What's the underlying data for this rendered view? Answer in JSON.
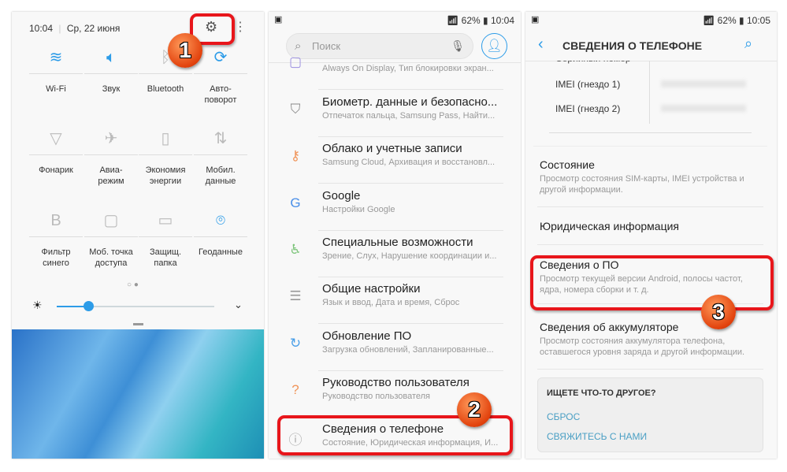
{
  "panel1": {
    "time": "10:04",
    "date": "Ср, 22 июня",
    "tiles": [
      {
        "label": "Wi-Fi",
        "icon": "wifi-icon",
        "glyph": "≋",
        "on": true
      },
      {
        "label": "Звук",
        "icon": "sound-icon",
        "glyph": "🔈︎",
        "on": true
      },
      {
        "label": "Bluetooth",
        "icon": "bluetooth-icon",
        "glyph": "ᛒ",
        "on": false
      },
      {
        "label": "Авто-\nповорот",
        "icon": "autorotate-icon",
        "glyph": "⟳",
        "on": true
      },
      {
        "label": "Фонарик",
        "icon": "flashlight-icon",
        "glyph": "▽",
        "on": false
      },
      {
        "label": "Авиа-\nрежим",
        "icon": "airplane-icon",
        "glyph": "✈",
        "on": false
      },
      {
        "label": "Экономия\nэнергии",
        "icon": "battery-saver-icon",
        "glyph": "▯",
        "on": false
      },
      {
        "label": "Мобил.\nданные",
        "icon": "mobile-data-icon",
        "glyph": "⇅",
        "on": false
      },
      {
        "label": "Фильтр\nсинего",
        "icon": "blue-filter-icon",
        "glyph": "B",
        "on": false
      },
      {
        "label": "Моб. точка\nдоступа",
        "icon": "hotspot-icon",
        "glyph": "▢",
        "on": false
      },
      {
        "label": "Защищ.\nпапка",
        "icon": "secure-folder-icon",
        "glyph": "▭",
        "on": false
      },
      {
        "label": "Геоданные",
        "icon": "location-icon",
        "glyph": "⌾",
        "on": true
      }
    ],
    "brightness": 0.2
  },
  "panel2": {
    "status": {
      "battery": "62%",
      "time": "10:04"
    },
    "search_placeholder": "Поиск",
    "items": [
      {
        "title": "",
        "subtitle": "Always On Display, Тип блокировки экран...",
        "icon": "lock-screen-icon",
        "glyph": "▢",
        "color": "#9b8fe0"
      },
      {
        "title": "Биометр. данные и безопасно...",
        "subtitle": "Отпечаток пальца, Samsung Pass, Найти...",
        "icon": "shield-icon",
        "glyph": "⛉",
        "color": "#888"
      },
      {
        "title": "Облако и учетные записи",
        "subtitle": "Samsung Cloud, Архивация и восстановл...",
        "icon": "key-icon",
        "glyph": "⚷",
        "color": "#f0955a"
      },
      {
        "title": "Google",
        "subtitle": "Настройки Google",
        "icon": "google-icon",
        "glyph": "G",
        "color": "#4a8fe8"
      },
      {
        "title": "Специальные возможности",
        "subtitle": "Зрение, Слух, Нарушение координации и...",
        "icon": "accessibility-icon",
        "glyph": "♿︎",
        "color": "#7cc47a"
      },
      {
        "title": "Общие настройки",
        "subtitle": "Язык и ввод, Дата и время, Сброс",
        "icon": "sliders-icon",
        "glyph": "☰",
        "color": "#999"
      },
      {
        "title": "Обновление ПО",
        "subtitle": "Загрузка обновлений, Запланированные...",
        "icon": "software-update-icon",
        "glyph": "↻",
        "color": "#4a9fe8"
      },
      {
        "title": "Руководство пользователя",
        "subtitle": "Руководство пользователя",
        "icon": "user-manual-icon",
        "glyph": "?",
        "color": "#f0955a"
      },
      {
        "title": "Сведения о телефоне",
        "subtitle": "Состояние, Юридическая информация, И...",
        "icon": "info-icon",
        "glyph": "ⓘ",
        "color": "#aaa"
      }
    ]
  },
  "panel3": {
    "status": {
      "battery": "62%",
      "time": "10:05"
    },
    "title": "СВЕДЕНИЯ О ТЕЛЕФОНЕ",
    "cut_row": "Серийный номер",
    "imei1": "IMEI (гнездо 1)",
    "imei2": "IMEI (гнездо 2)",
    "items": [
      {
        "title": "Состояние",
        "subtitle": "Просмотр состояния SIM-карты, IMEI устройства и другой информации."
      },
      {
        "title": "Юридическая информация",
        "subtitle": ""
      },
      {
        "title": "Сведения о ПО",
        "subtitle": "Просмотр текущей версии Android, полосы частот, ядра, номера сборки и т. д."
      },
      {
        "title": "Сведения об аккумуляторе",
        "subtitle": "Просмотр состояния аккумулятора телефона, оставшегося уровня заряда и другой информации."
      }
    ],
    "looking": {
      "heading": "ИЩЕТЕ ЧТО-ТО ДРУГОЕ?",
      "links": [
        "СБРОС",
        "СВЯЖИТЕСЬ С НАМИ"
      ]
    }
  },
  "badges": [
    "1",
    "2",
    "3"
  ],
  "colors": {
    "accent": "#2d9ce8",
    "highlight": "#e8161b",
    "badge": "#e2420d"
  }
}
